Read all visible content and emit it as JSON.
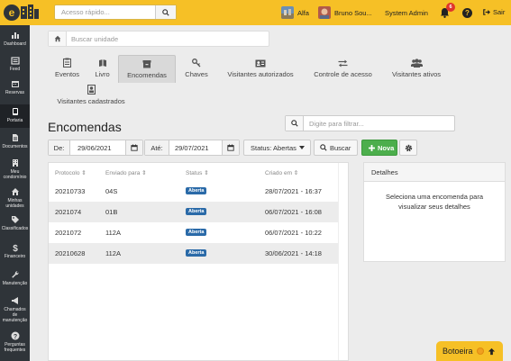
{
  "topbar": {
    "search_placeholder": "Acesso rápido...",
    "condo_name": "Alfa",
    "user_name": "Bruno Sou...",
    "role": "System Admin",
    "notifications_count": "6",
    "logout_label": "Sair",
    "help_glyph": "?"
  },
  "sidebar": {
    "items": [
      {
        "label": "Dashboard",
        "icon": "dashboard-icon"
      },
      {
        "label": "Feed",
        "icon": "feed-icon"
      },
      {
        "label": "Reservas",
        "icon": "calendar-icon"
      },
      {
        "label": "Portaria",
        "icon": "tablet-icon"
      },
      {
        "label": "Documentos",
        "icon": "document-icon"
      },
      {
        "label": "Meu condomínio",
        "icon": "building-icon"
      },
      {
        "label": "Minhas unidades",
        "icon": "home-icon"
      },
      {
        "label": "Classificados",
        "icon": "tag-icon"
      },
      {
        "label": "Financeiro",
        "icon": "dollar-icon"
      },
      {
        "label": "Manutenção",
        "icon": "wrench-icon"
      },
      {
        "label": "Chamados de manutenção",
        "icon": "megaphone-icon"
      },
      {
        "label": "Perguntas frequentes",
        "icon": "question-icon"
      }
    ]
  },
  "breadcrumb": {
    "placeholder": "Buscar unidade"
  },
  "tabs": [
    {
      "label": "Eventos"
    },
    {
      "label": "Livro"
    },
    {
      "label": "Encomendas"
    },
    {
      "label": "Chaves"
    },
    {
      "label": "Visitantes autorizados"
    },
    {
      "label": "Controle de acesso"
    },
    {
      "label": "Visitantes ativos"
    },
    {
      "label": "Visitantes cadastrados"
    }
  ],
  "page": {
    "title": "Encomendas",
    "filter_placeholder": "Digite para filtrar..."
  },
  "toolbar": {
    "from_label": "De:",
    "from_value": "29/06/2021",
    "to_label": "Até:",
    "to_value": "29/07/2021",
    "status_label": "Status: Abertas",
    "search_label": "Buscar",
    "new_label": "Nova"
  },
  "table": {
    "headers": [
      "Protocolo",
      "Enviado para",
      "Status",
      "Criado em"
    ],
    "rows": [
      {
        "protocolo": "20210733",
        "enviado": "04S",
        "status": "Aberta",
        "criado": "28/07/2021 - 16:37"
      },
      {
        "protocolo": "2021074",
        "enviado": "01B",
        "status": "Aberta",
        "criado": "06/07/2021 - 16:08"
      },
      {
        "protocolo": "2021072",
        "enviado": "112A",
        "status": "Aberta",
        "criado": "06/07/2021 - 10:22"
      },
      {
        "protocolo": "20210628",
        "enviado": "112A",
        "status": "Aberta",
        "criado": "30/06/2021 - 14:18"
      }
    ]
  },
  "details": {
    "title": "Detalhes",
    "message": "Seleciona uma encomenda para visualizar seus detalhes"
  },
  "botoeira": {
    "label": "Botoeira"
  },
  "colors": {
    "brand_yellow": "#f6c026",
    "sidebar": "#2f3439",
    "status_blue": "#2a6aa8",
    "new_green": "#4cae4c",
    "badge_red": "#e0342b"
  }
}
